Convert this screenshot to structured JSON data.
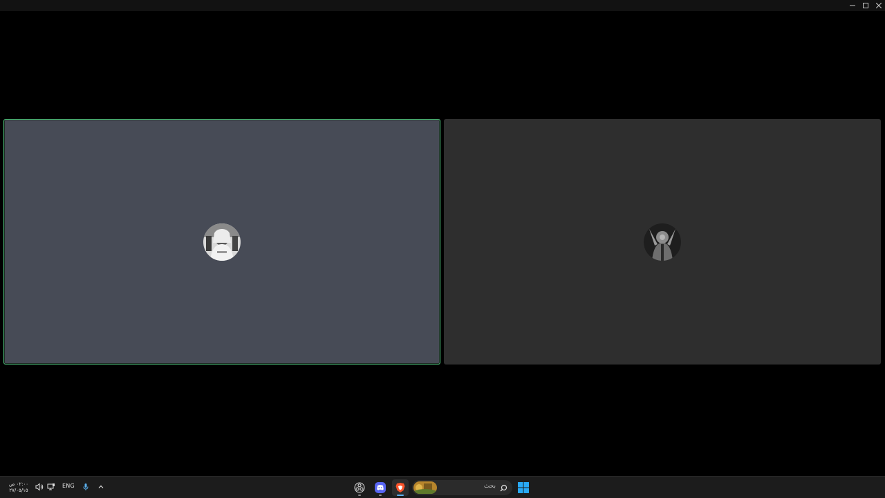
{
  "titlebar": {
    "minimize_icon": "minimize-icon",
    "maximize_icon": "maximize-icon",
    "close_icon": "close-icon"
  },
  "participants": [
    {
      "avatar_icon": "user-avatar-photo",
      "speaking": true,
      "accent": "#4ec27b"
    },
    {
      "avatar_icon": "user-avatar-photo",
      "speaking": false
    }
  ],
  "taskbar": {
    "clock": {
      "time": "٠٢:٠٠ ص",
      "date": "٢٧/٠٥/١٥"
    },
    "language": "ENG",
    "tray_icons": [
      "speaker-icon",
      "network-icon",
      "microphone-icon",
      "chevron-up-icon"
    ],
    "apps": [
      "obs-icon",
      "discord-icon",
      "brave-icon"
    ],
    "search": {
      "placeholder": "بحث"
    },
    "start_icon": "windows-start-icon",
    "colors": {
      "discord": "#5865f2",
      "brave": "#fb542b",
      "start": "#29a8f4"
    }
  }
}
